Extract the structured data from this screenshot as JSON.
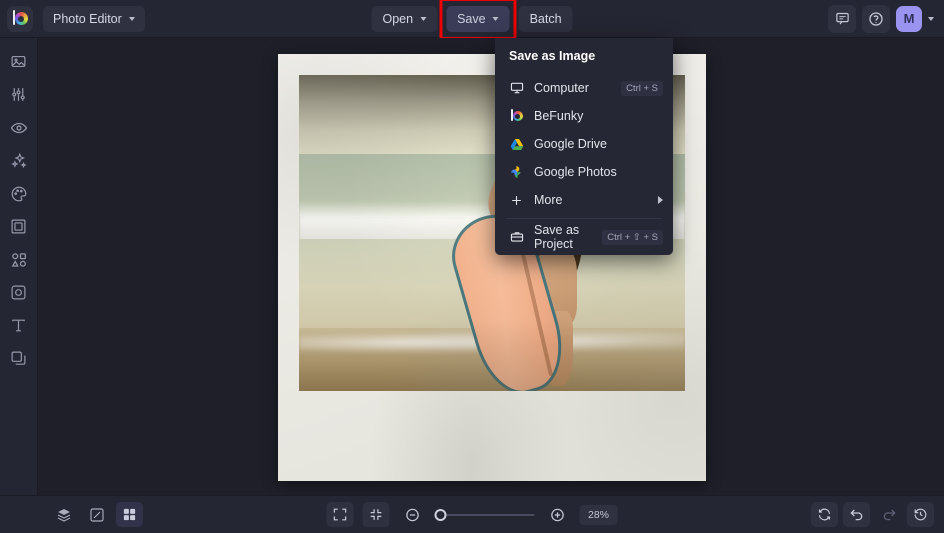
{
  "app": {
    "logo": "befunky-logo-icon",
    "switcher_label": "Photo Editor"
  },
  "header": {
    "open_label": "Open",
    "save_label": "Save",
    "batch_label": "Batch",
    "chat_icon": "chat-icon",
    "help_icon": "help-icon",
    "avatar_initial": "M",
    "save_highlight_color": "#ee0000",
    "avatar_color": "#9b93f0"
  },
  "sidebar": {
    "items": [
      {
        "name": "image-icon",
        "title": "Image"
      },
      {
        "name": "sliders-icon",
        "title": "Edit"
      },
      {
        "name": "eye-icon",
        "title": "Touch Up"
      },
      {
        "name": "sparkles-icon",
        "title": "Effects"
      },
      {
        "name": "palette-icon",
        "title": "Artsy"
      },
      {
        "name": "frame-icon",
        "title": "Frames"
      },
      {
        "name": "shapes-icon",
        "title": "Graphics"
      },
      {
        "name": "overlay-icon",
        "title": "Overlays"
      },
      {
        "name": "text-icon",
        "title": "Text"
      },
      {
        "name": "layers-icon",
        "title": "Layers"
      }
    ]
  },
  "save_menu": {
    "title": "Save as Image",
    "items": [
      {
        "label": "Computer",
        "icon": "computer-icon",
        "shortcut": "Ctrl + S",
        "submenu": false
      },
      {
        "label": "BeFunky",
        "icon": "befunky-icon",
        "shortcut": "",
        "submenu": false
      },
      {
        "label": "Google Drive",
        "icon": "google-drive-icon",
        "shortcut": "",
        "submenu": false
      },
      {
        "label": "Google Photos",
        "icon": "google-photos-icon",
        "shortcut": "",
        "submenu": false
      },
      {
        "label": "More",
        "icon": "plus-icon",
        "shortcut": "",
        "submenu": true
      }
    ],
    "project_item": {
      "label": "Save as Project",
      "icon": "briefcase-icon",
      "shortcut": "Ctrl + ⇧ + S"
    }
  },
  "canvas": {
    "image_description": "Surfer walking into the ocean holding a surfboard, framed in a white polaroid border"
  },
  "bottombar": {
    "layers_icon": "layers-stack-icon",
    "resize_icon": "resize-icon",
    "grid_icon": "grid-icon",
    "fit_icon": "fit-to-screen-icon",
    "shrink_icon": "actual-size-icon",
    "zoom_out_icon": "zoom-out-icon",
    "zoom_in_icon": "zoom-in-icon",
    "zoom_percent": "28%",
    "zoom_value": 28,
    "reset_icon": "reset-icon",
    "undo_icon": "undo-icon",
    "redo_icon": "redo-icon",
    "history_icon": "history-icon"
  }
}
